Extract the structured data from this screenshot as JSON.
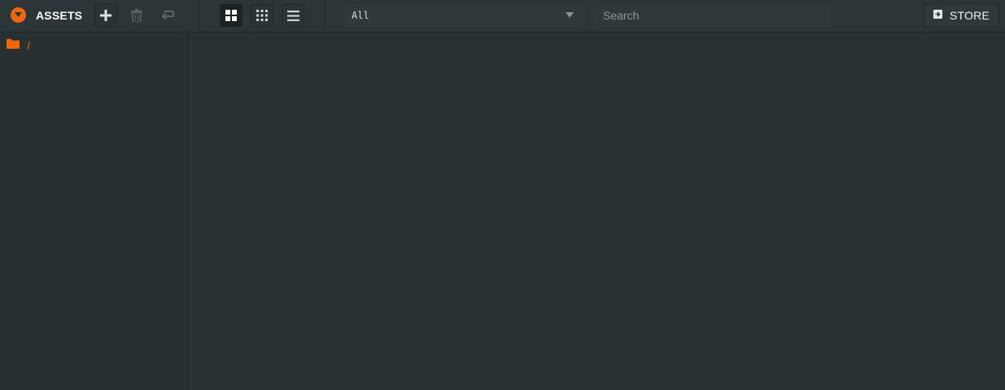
{
  "panel": {
    "title": "ASSETS"
  },
  "toolbar": {
    "icons": {
      "collapse": "chevron-down-icon",
      "add": "plus-icon",
      "delete": "trash-icon",
      "back": "return-icon",
      "view_large_grid": "grid-large-icon",
      "view_small_grid": "grid-small-icon",
      "view_list": "list-icon",
      "store": "store-icon"
    },
    "filter": {
      "selected": "All"
    },
    "search": {
      "placeholder": "Search"
    },
    "store_label": "STORE"
  },
  "sidebar": {
    "tree": [
      {
        "label": "/",
        "icon": "folder-icon"
      }
    ]
  },
  "colors": {
    "accent": "#f0660a",
    "toolbar_bg": "#2c3638",
    "panel_bg": "#283133",
    "field_bg": "#2f393b"
  }
}
